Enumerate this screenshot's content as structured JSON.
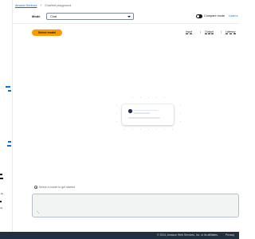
{
  "breadcrumb": {
    "root": "Amazon Bedrock",
    "separator": "›",
    "current": "Chat/text playground"
  },
  "mode": {
    "label": "Mode",
    "selected": "Chat"
  },
  "compare": {
    "label": "Compare mode",
    "enabled": false
  },
  "load_link": "Load e",
  "actions": {
    "select_model": "Select model"
  },
  "metrics": {
    "items": [
      "Input",
      "Output",
      "Latency"
    ],
    "separator": "|"
  },
  "hint": "Select a model to get started",
  "input": {
    "resize_icon": "resize-corner"
  },
  "footer": {
    "copyright": "© 2024, Amazon Web Services, Inc. or its affiliates.",
    "privacy": "Privacy"
  },
  "sidebar": {
    "fragments": [
      "rs",
      "ns"
    ]
  },
  "colors": {
    "accent": "#ff9900",
    "link": "#0972d3",
    "footer_bg": "#232f3e",
    "sidebar_link": "#0972d3"
  }
}
